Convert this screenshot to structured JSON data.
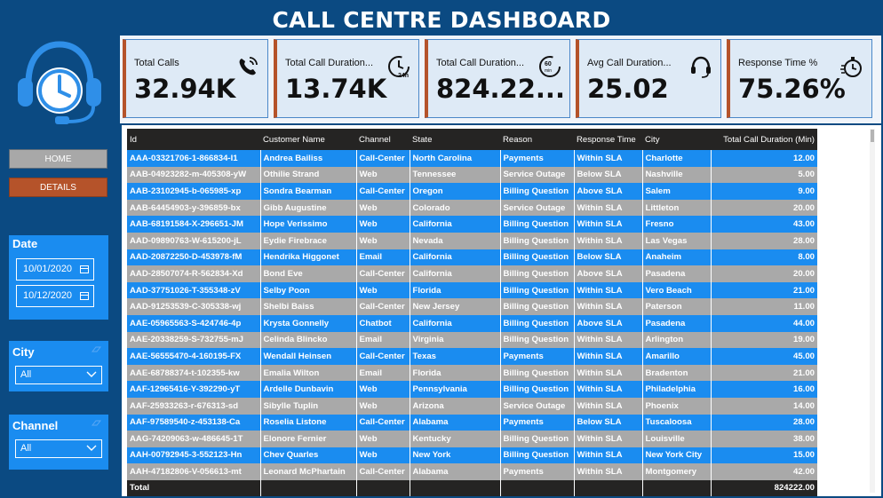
{
  "title": "CALL CENTRE DASHBOARD",
  "nav": {
    "home_label": "HOME",
    "details_label": "DETAILS"
  },
  "filters": {
    "date": {
      "label": "Date",
      "start": "10/01/2020",
      "end": "10/12/2020"
    },
    "city": {
      "label": "City",
      "value": "All"
    },
    "channel": {
      "label": "Channel",
      "value": "All"
    }
  },
  "kpis": [
    {
      "label": "Total Calls",
      "value": "32.94K",
      "icon": "phone-ringing-icon"
    },
    {
      "label": "Total Call Duration...",
      "value": "13.74K",
      "icon": "clock-24h-icon"
    },
    {
      "label": "Total Call Duration...",
      "value": "824.22...",
      "icon": "clock-60min-icon"
    },
    {
      "label": "Avg Call Duration...",
      "value": "25.02",
      "icon": "headset-icon"
    },
    {
      "label": "Response Time %",
      "value": "75.26%",
      "icon": "stopwatch-icon"
    }
  ],
  "table": {
    "columns": [
      "Id",
      "Customer Name",
      "Channel",
      "State",
      "Reason",
      "Response Time",
      "City",
      "Total Call Duration (Min)"
    ],
    "rows": [
      [
        "AAA-03321706-1-866834-I1",
        "Andrea Bailiss",
        "Call-Center",
        "North Carolina",
        "Payments",
        "Within SLA",
        "Charlotte",
        "12.00"
      ],
      [
        "AAB-04923282-m-405308-yW",
        "Othilie Strand",
        "Web",
        "Tennessee",
        "Service Outage",
        "Below SLA",
        "Nashville",
        "5.00"
      ],
      [
        "AAB-23102945-b-065985-xp",
        "Sondra Bearman",
        "Call-Center",
        "Oregon",
        "Billing Question",
        "Above SLA",
        "Salem",
        "9.00"
      ],
      [
        "AAB-64454903-y-396859-bx",
        "Gibb Augustine",
        "Web",
        "Colorado",
        "Service Outage",
        "Within SLA",
        "Littleton",
        "20.00"
      ],
      [
        "AAB-68191584-X-296651-JM",
        "Hope Verissimo",
        "Web",
        "California",
        "Billing Question",
        "Within SLA",
        "Fresno",
        "43.00"
      ],
      [
        "AAD-09890763-W-615200-jL",
        "Eydie Firebrace",
        "Web",
        "Nevada",
        "Billing Question",
        "Within SLA",
        "Las Vegas",
        "28.00"
      ],
      [
        "AAD-20872250-D-453978-fM",
        "Hendrika Higgonet",
        "Email",
        "California",
        "Billing Question",
        "Below SLA",
        "Anaheim",
        "8.00"
      ],
      [
        "AAD-28507074-R-562834-Xd",
        "Bond Eve",
        "Call-Center",
        "California",
        "Billing Question",
        "Above SLA",
        "Pasadena",
        "20.00"
      ],
      [
        "AAD-37751026-T-355348-zV",
        "Selby Poon",
        "Web",
        "Florida",
        "Billing Question",
        "Within SLA",
        "Vero Beach",
        "21.00"
      ],
      [
        "AAD-91253539-C-305338-wj",
        "Shelbi Baiss",
        "Call-Center",
        "New Jersey",
        "Billing Question",
        "Within SLA",
        "Paterson",
        "11.00"
      ],
      [
        "AAE-05965563-S-424746-4p",
        "Krysta Gonnelly",
        "Chatbot",
        "California",
        "Billing Question",
        "Above SLA",
        "Pasadena",
        "44.00"
      ],
      [
        "AAE-20338259-S-732755-mJ",
        "Celinda Blincko",
        "Email",
        "Virginia",
        "Billing Question",
        "Within SLA",
        "Arlington",
        "19.00"
      ],
      [
        "AAE-56555470-4-160195-FX",
        "Wendall Heinsen",
        "Call-Center",
        "Texas",
        "Payments",
        "Within SLA",
        "Amarillo",
        "45.00"
      ],
      [
        "AAE-68788374-t-102355-kw",
        "Emalia Wilton",
        "Email",
        "Florida",
        "Billing Question",
        "Within SLA",
        "Bradenton",
        "21.00"
      ],
      [
        "AAF-12965416-Y-392290-yT",
        "Ardelle Dunbavin",
        "Web",
        "Pennsylvania",
        "Billing Question",
        "Within SLA",
        "Philadelphia",
        "16.00"
      ],
      [
        "AAF-25933263-r-676313-sd",
        "Sibylle Tuplin",
        "Web",
        "Arizona",
        "Service Outage",
        "Within SLA",
        "Phoenix",
        "14.00"
      ],
      [
        "AAF-97589540-z-453138-Ca",
        "Roselia Listone",
        "Call-Center",
        "Alabama",
        "Payments",
        "Below SLA",
        "Tuscaloosa",
        "28.00"
      ],
      [
        "AAG-74209063-w-486645-1T",
        "Elonore Fernier",
        "Web",
        "Kentucky",
        "Billing Question",
        "Within SLA",
        "Louisville",
        "38.00"
      ],
      [
        "AAH-00792945-3-552123-Hn",
        "Chev Quarles",
        "Web",
        "New York",
        "Billing Question",
        "Within SLA",
        "New York City",
        "15.00"
      ],
      [
        "AAH-47182806-V-056613-mt",
        "Leonard McPhartain",
        "Call-Center",
        "Alabama",
        "Payments",
        "Within SLA",
        "Montgomery",
        "42.00"
      ]
    ],
    "total_label": "Total",
    "total_value": "824222.00"
  },
  "colors": {
    "header_bg": "#0b4a82",
    "accent_blue": "#1a8cf0",
    "accent_orange": "#b5532a",
    "row_gray": "#a9a9a9",
    "table_header": "#252423"
  }
}
